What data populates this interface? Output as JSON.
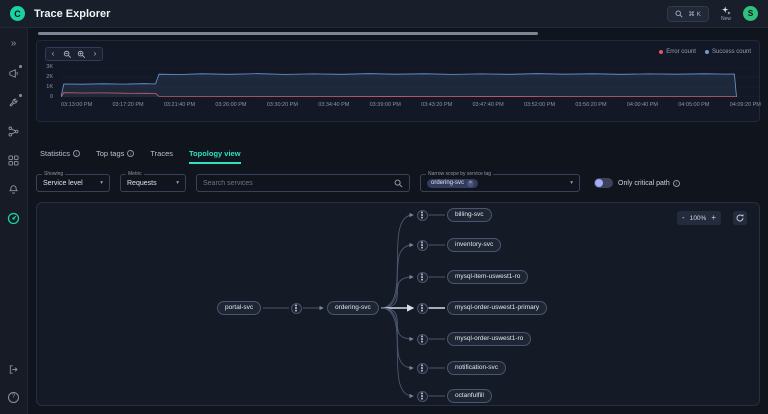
{
  "header": {
    "logo_letter": "C",
    "title": "Trace Explorer",
    "shortcut": "⌘ K",
    "new_label": "New",
    "avatar": "S"
  },
  "icons": {
    "expand": "»",
    "chev_left": "‹",
    "chev_right": "›",
    "caret": "▾",
    "close": "×",
    "info_letter": "i",
    "help": "?"
  },
  "sidebar": {
    "items": [
      "expand",
      "announcements",
      "setup",
      "data-flow",
      "dashboards",
      "alerts",
      "tracing"
    ],
    "active": "tracing",
    "bottom": [
      "export",
      "help"
    ]
  },
  "tabs": [
    {
      "label": "Statistics",
      "info": true,
      "active": false
    },
    {
      "label": "Top tags",
      "info": true,
      "active": false
    },
    {
      "label": "Traces",
      "info": false,
      "active": false
    },
    {
      "label": "Topology view",
      "info": false,
      "active": true
    }
  ],
  "filters": {
    "showing": {
      "label": "Showing",
      "value": "Service level"
    },
    "metric": {
      "label": "Metric",
      "value": "Requests"
    },
    "search_placeholder": "Search services",
    "scope": {
      "label": "Narrow scope by service tag",
      "chip": "ordering-svc"
    },
    "toggle_label": "Only critical path",
    "toggle_on": false
  },
  "chart": {
    "type": "line",
    "ylim": [
      0,
      3000
    ],
    "yticks": [
      "3K",
      "2K",
      "1K",
      "0"
    ],
    "xticks": [
      "03:13:00 PM",
      "03:17:20 PM",
      "03:21:40 PM",
      "03:26:00 PM",
      "03:30:20 PM",
      "03:34:40 PM",
      "03:39:00 PM",
      "03:43:20 PM",
      "03:47:40 PM",
      "03:52:00 PM",
      "03:56:20 PM",
      "04:00:40 PM",
      "04:05:00 PM",
      "04:09:20 PM"
    ],
    "legend_position": "top-right",
    "series": [
      {
        "name": "Error count",
        "color": "#e0585e",
        "points": [
          [
            0,
            0
          ],
          [
            0.004,
            430
          ],
          [
            0.03,
            400
          ],
          [
            0.06,
            415
          ],
          [
            0.09,
            380
          ],
          [
            0.12,
            370
          ],
          [
            0.135,
            355
          ],
          [
            0.14,
            60
          ],
          [
            0.25,
            50
          ],
          [
            0.4,
            58
          ],
          [
            0.55,
            48
          ],
          [
            0.7,
            55
          ],
          [
            0.85,
            50
          ],
          [
            0.962,
            52
          ],
          [
            0.965,
            0
          ]
        ]
      },
      {
        "name": "Success count",
        "color": "#6e9cd2",
        "fill": "rgba(110,156,210,0.12)",
        "points": [
          [
            0,
            0
          ],
          [
            0.004,
            1300
          ],
          [
            0.03,
            1280
          ],
          [
            0.06,
            1320
          ],
          [
            0.09,
            1290
          ],
          [
            0.12,
            1330
          ],
          [
            0.135,
            1300
          ],
          [
            0.14,
            2280
          ],
          [
            0.17,
            2250
          ],
          [
            0.2,
            2320
          ],
          [
            0.24,
            2270
          ],
          [
            0.28,
            2330
          ],
          [
            0.32,
            2260
          ],
          [
            0.36,
            2310
          ],
          [
            0.4,
            2270
          ],
          [
            0.44,
            2330
          ],
          [
            0.48,
            2280
          ],
          [
            0.52,
            2320
          ],
          [
            0.56,
            2260
          ],
          [
            0.6,
            2310
          ],
          [
            0.64,
            2270
          ],
          [
            0.68,
            2330
          ],
          [
            0.72,
            2280
          ],
          [
            0.76,
            2320
          ],
          [
            0.8,
            2270
          ],
          [
            0.84,
            2310
          ],
          [
            0.88,
            2280
          ],
          [
            0.92,
            2320
          ],
          [
            0.95,
            2290
          ],
          [
            0.962,
            2300
          ],
          [
            0.965,
            0
          ]
        ]
      }
    ]
  },
  "topology": {
    "controls": {
      "zoom_out": "-",
      "zoom_label": "100%",
      "zoom_in": "+"
    },
    "nodes": {
      "source": "portal-svc",
      "hub": "ordering-svc",
      "targets": [
        "billing-svc",
        "inventory-svc",
        "mysql-item-uswest1-ro",
        "mysql-order-uswest1-primary",
        "mysql-order-uswest1-ro",
        "notification-svc",
        "octanfulfill"
      ],
      "highlighted_target": "mysql-order-uswest1-primary"
    }
  }
}
